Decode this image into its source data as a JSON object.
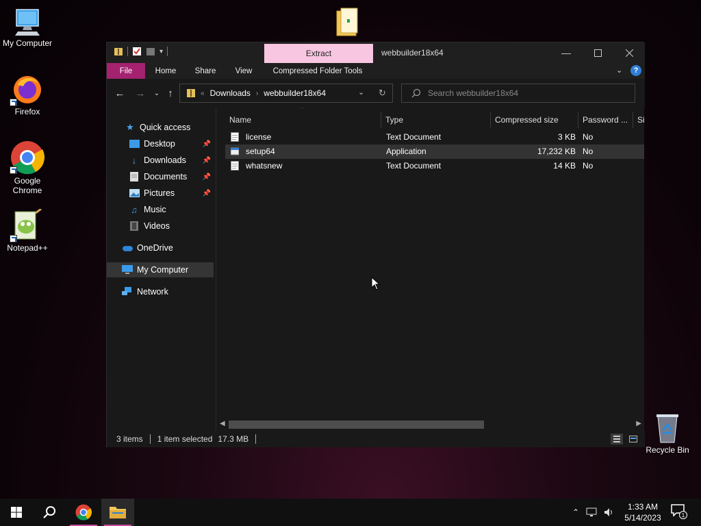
{
  "desktop": {
    "icons": [
      {
        "label": "My Computer"
      },
      {
        "label": "Firefox"
      },
      {
        "label": "Google Chrome"
      },
      {
        "label": "Notepad++"
      },
      {
        "label": "Recycle Bin"
      }
    ]
  },
  "window": {
    "title": "webbuilder18x64",
    "context_tab": "Extract",
    "ribbon_tabs": [
      "File",
      "Home",
      "Share",
      "View",
      "Compressed Folder Tools"
    ],
    "address": {
      "crumbs": [
        "Downloads",
        "webbuilder18x64"
      ]
    },
    "search": {
      "placeholder": "Search webbuilder18x64"
    }
  },
  "nav_pane": {
    "items": [
      {
        "label": "Quick access"
      },
      {
        "label": "Desktop"
      },
      {
        "label": "Downloads"
      },
      {
        "label": "Documents"
      },
      {
        "label": "Pictures"
      },
      {
        "label": "Music"
      },
      {
        "label": "Videos"
      },
      {
        "label": "OneDrive"
      },
      {
        "label": "My Computer"
      },
      {
        "label": "Network"
      }
    ]
  },
  "file_list": {
    "columns": [
      "Name",
      "Type",
      "Compressed size",
      "Password ...",
      "Si"
    ],
    "rows": [
      {
        "name": "license",
        "type": "Text Document",
        "size": "3 KB",
        "password": "No"
      },
      {
        "name": "setup64",
        "type": "Application",
        "size": "17,232 KB",
        "password": "No"
      },
      {
        "name": "whatsnew",
        "type": "Text Document",
        "size": "14 KB",
        "password": "No"
      }
    ]
  },
  "status": {
    "items": "3 items",
    "selected": "1 item selected",
    "size": "17.3 MB"
  },
  "taskbar": {
    "time": "1:33 AM",
    "date": "5/14/2023",
    "notification_count": "1"
  }
}
